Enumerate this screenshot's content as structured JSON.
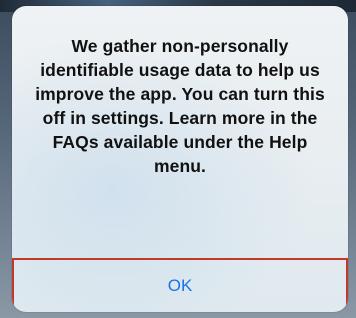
{
  "alert": {
    "message": "We gather non-personally identifiable usage data to help us improve the app. You can turn this off in settings. Learn more in the FAQs available under the Help menu.",
    "ok_label": "OK"
  },
  "colors": {
    "button_text": "#1a73e8",
    "button_outline": "#c0392b",
    "message_text": "#111111"
  }
}
